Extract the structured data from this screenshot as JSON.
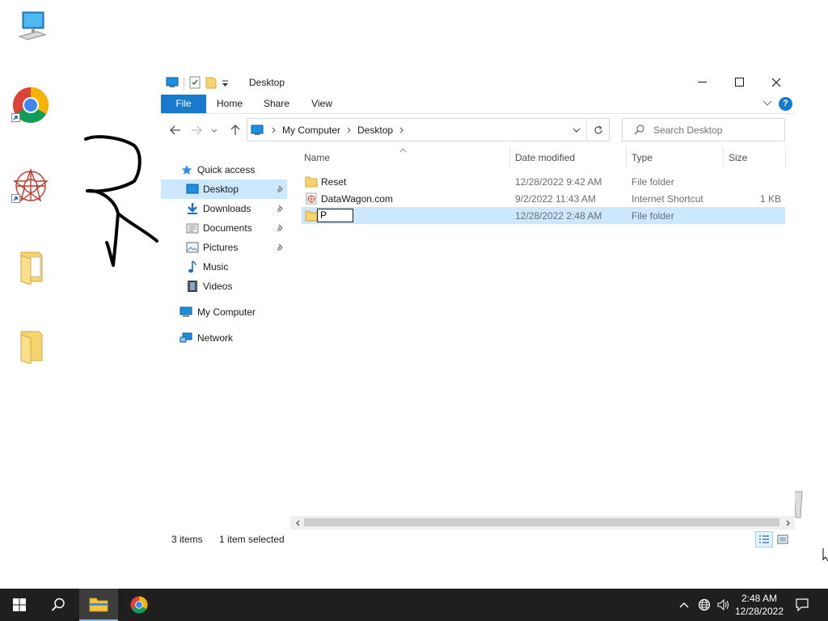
{
  "window": {
    "title": "Desktop",
    "ribbon_tabs": [
      "File",
      "Home",
      "Share",
      "View"
    ],
    "help_label": "?"
  },
  "address": {
    "crumbs": [
      "My Computer",
      "Desktop"
    ]
  },
  "search": {
    "placeholder": "Search Desktop"
  },
  "nav_pane": {
    "quick_access": "Quick access",
    "items": [
      {
        "label": "Desktop",
        "icon": "desktop-icon",
        "pinned": true
      },
      {
        "label": "Downloads",
        "icon": "downloads-icon",
        "pinned": true
      },
      {
        "label": "Documents",
        "icon": "documents-icon",
        "pinned": true
      },
      {
        "label": "Pictures",
        "icon": "pictures-icon",
        "pinned": true
      },
      {
        "label": "Music",
        "icon": "music-icon",
        "pinned": false
      },
      {
        "label": "Videos",
        "icon": "videos-icon",
        "pinned": false
      }
    ],
    "my_computer": "My Computer",
    "network": "Network"
  },
  "columns": {
    "name": "Name",
    "date": "Date modified",
    "type": "Type",
    "size": "Size"
  },
  "files": [
    {
      "name": "Reset",
      "date": "12/28/2022 9:42 AM",
      "type": "File folder",
      "size": "",
      "icon": "folder-icon"
    },
    {
      "name": "DataWagon.com",
      "date": "9/2/2022 11:43 AM",
      "type": "Internet Shortcut",
      "size": "1 KB",
      "icon": "internet-shortcut-icon"
    },
    {
      "name": "",
      "date": "12/28/2022 2:48 AM",
      "type": "File folder",
      "size": "",
      "icon": "folder-icon",
      "renaming": true
    }
  ],
  "rename_value": "P",
  "status": {
    "items": "3 items",
    "selected": "1 item selected"
  },
  "taskbar": {
    "time": "2:48 AM",
    "date": "12/28/2022"
  },
  "colors": {
    "accent": "#1979ca",
    "selection": "#cce8ff",
    "taskbar": "#1f1f1f"
  }
}
